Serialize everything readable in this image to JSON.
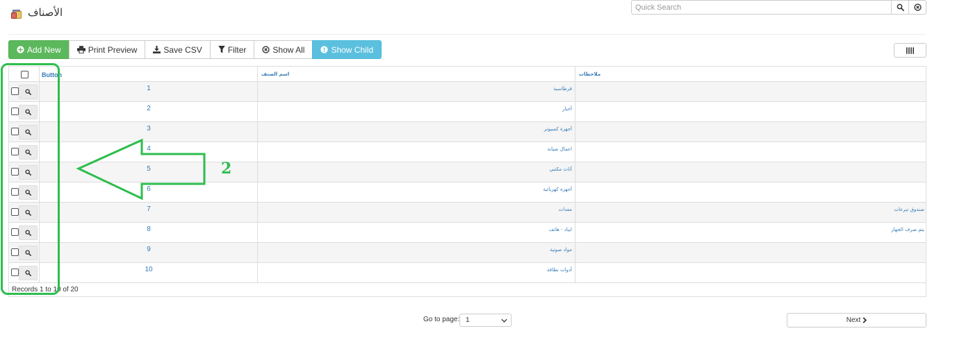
{
  "page": {
    "title": "الأصناف",
    "icon": "category-icon"
  },
  "search": {
    "placeholder": "Quick Search",
    "value": ""
  },
  "toolbar": {
    "add_new": "Add New",
    "print_preview": "Print Preview",
    "save_csv": "Save CSV",
    "filter": "Filter",
    "show_all": "Show All",
    "show_child": "Show Child"
  },
  "grid": {
    "columns": [
      "Button",
      "اسم الصنف",
      "ملاحظات"
    ],
    "rows": [
      {
        "num": "1",
        "name": "قرطاسية",
        "notes": ""
      },
      {
        "num": "2",
        "name": "أحبار",
        "notes": ""
      },
      {
        "num": "3",
        "name": "أجهزة كمبيوتر",
        "notes": ""
      },
      {
        "num": "4",
        "name": "اعمال صيانة",
        "notes": ""
      },
      {
        "num": "5",
        "name": "أثاث مكتبي",
        "notes": ""
      },
      {
        "num": "6",
        "name": "أجهزة كهربائية",
        "notes": ""
      },
      {
        "num": "7",
        "name": "معدات",
        "notes": "صندوق تبرعات"
      },
      {
        "num": "8",
        "name": "ايباد - هاتف",
        "notes": "يتم صرف الجهاز"
      },
      {
        "num": "9",
        "name": "مواد صوتية",
        "notes": ""
      },
      {
        "num": "10",
        "name": "أدوات نظافة",
        "notes": ""
      }
    ],
    "records_text": "Records 1 to 10 of 20"
  },
  "pager": {
    "goto_label": "Go to page:",
    "page_value": "1",
    "next_label": "Next"
  },
  "annotation": {
    "number": "2",
    "color": "#2ebd4e"
  },
  "colors": {
    "link": "#337ab7",
    "success": "#5cb85c",
    "info": "#5bc0de"
  }
}
